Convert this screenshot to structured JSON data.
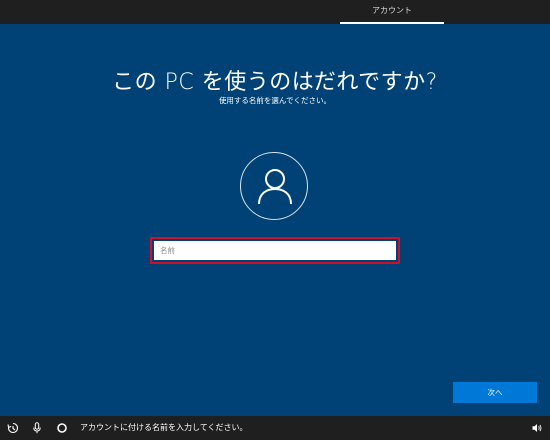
{
  "topbar": {
    "tab_label": "アカウント"
  },
  "main": {
    "title": "この PC を使うのはだれですか?",
    "subtitle": "使用する名前を選んでください。",
    "name_field": {
      "placeholder": "名前",
      "value": ""
    },
    "next_button_label": "次へ"
  },
  "bottombar": {
    "status_text": "アカウントに付ける名前を入力してください。",
    "icons": [
      "ease-of-access-icon",
      "microphone-icon",
      "cortana-icon",
      "speaker-icon"
    ]
  },
  "colors": {
    "background": "#004275",
    "bar": "#1f1f1f",
    "accent": "#0078d7",
    "highlight_border": "#d0102a"
  }
}
